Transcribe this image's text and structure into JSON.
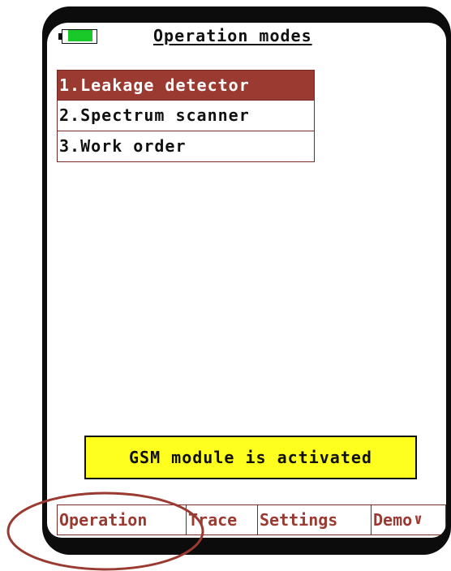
{
  "header": {
    "title": "Operation modes",
    "battery_icon": "battery-icon"
  },
  "menu": {
    "items": [
      {
        "label": "1.Leakage detector",
        "selected": true
      },
      {
        "label": "2.Spectrum scanner",
        "selected": false
      },
      {
        "label": "3.Work order",
        "selected": false
      }
    ]
  },
  "status": {
    "message": "GSM module is activated"
  },
  "tabs": [
    {
      "label": "Operation"
    },
    {
      "label": "Trace"
    },
    {
      "label": "Settings"
    },
    {
      "label": "Demo"
    }
  ],
  "tab_more_glyph": "∨",
  "colors": {
    "accent": "#9a3a31",
    "battery": "#19c829",
    "status_bg": "#ffff1f",
    "annotation": "#9a3a31"
  }
}
